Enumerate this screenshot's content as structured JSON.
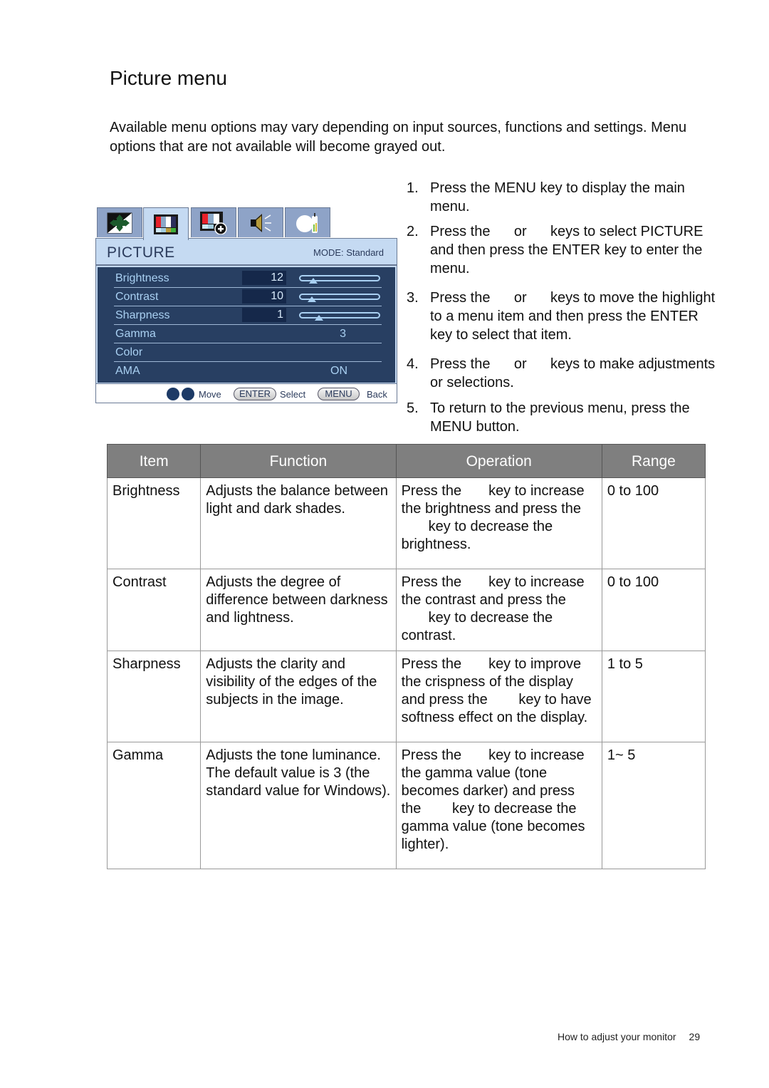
{
  "page": {
    "title": "Picture menu",
    "intro": "Available menu options may vary depending on input sources, functions and settings. Menu options that are not available will become grayed out."
  },
  "osd": {
    "tabs": [
      {
        "icon": "display-position-icon",
        "active": false
      },
      {
        "icon": "picture-icon",
        "active": true
      },
      {
        "icon": "picture-advanced-icon",
        "active": false
      },
      {
        "icon": "audio-icon",
        "active": false
      },
      {
        "icon": "system-icon",
        "active": false
      }
    ],
    "header_title": "PICTURE",
    "mode_label": "MODE: Standard",
    "rows": [
      {
        "label": "Brightness",
        "value": "12",
        "slider_fraction": 0.12
      },
      {
        "label": "Contrast",
        "value": "10",
        "slider_fraction": 0.1
      },
      {
        "label": "Sharpness",
        "value": "1",
        "slider_fraction": 0.2
      },
      {
        "label": "Gamma",
        "value": "3"
      },
      {
        "label": "Color",
        "value": ""
      },
      {
        "label": "AMA",
        "value": "ON"
      }
    ],
    "footer": {
      "move": "Move",
      "enter_key": "ENTER",
      "select": "Select",
      "menu_key": "MENU",
      "back": "Back"
    },
    "colors": {
      "panel": "#283f62",
      "header": "#c5daf2",
      "text": "#a9d0f2"
    }
  },
  "steps": [
    {
      "num": "1.",
      "text": "Press the MENU key to display the main menu."
    },
    {
      "num": "2.",
      "text": "Press the      or      keys to select PICTURE and then press the ENTER key to enter the menu."
    },
    {
      "num": "3.",
      "text": "Press the      or      keys to move the highlight to a menu item and then press the ENTER key to select that item."
    },
    {
      "num": "4.",
      "text": "Press the      or      keys to make adjustments or selections."
    },
    {
      "num": "5.",
      "text": "To return to the previous menu, press the MENU button."
    }
  ],
  "table": {
    "headers": [
      "Item",
      "Function",
      "Operation",
      "Range"
    ],
    "rows": [
      {
        "item": "Brightness",
        "function": "Adjusts the balance between light and dark shades.",
        "operation": [
          "Press the",
          "key to increase the brightness and press the",
          "key to decrease the brightness."
        ],
        "range": "0 to 100"
      },
      {
        "item": "Contrast",
        "function": "Adjusts the degree of difference between darkness and lightness.",
        "operation": [
          "Press the",
          "key to increase the contrast and press the",
          "key to decrease the contrast."
        ],
        "range": "0 to 100"
      },
      {
        "item": "Sharpness",
        "function": "Adjusts the clarity and visibility of the edges of the subjects in the image.",
        "operation": [
          "Press the",
          "key to improve the crispness of the display and press the",
          "key to have softness effect on the display."
        ],
        "range": "1 to 5"
      },
      {
        "item": "Gamma",
        "function": "Adjusts the tone luminance. The default value is 3 (the standard value for Windows).",
        "operation": [
          "Press the",
          "key to increase the gamma value (tone becomes darker) and press the",
          "key to decrease the gamma value (tone becomes lighter)."
        ],
        "range": "1~ 5"
      }
    ]
  },
  "footer": {
    "section": "How to adjust your monitor",
    "page_number": "29"
  }
}
